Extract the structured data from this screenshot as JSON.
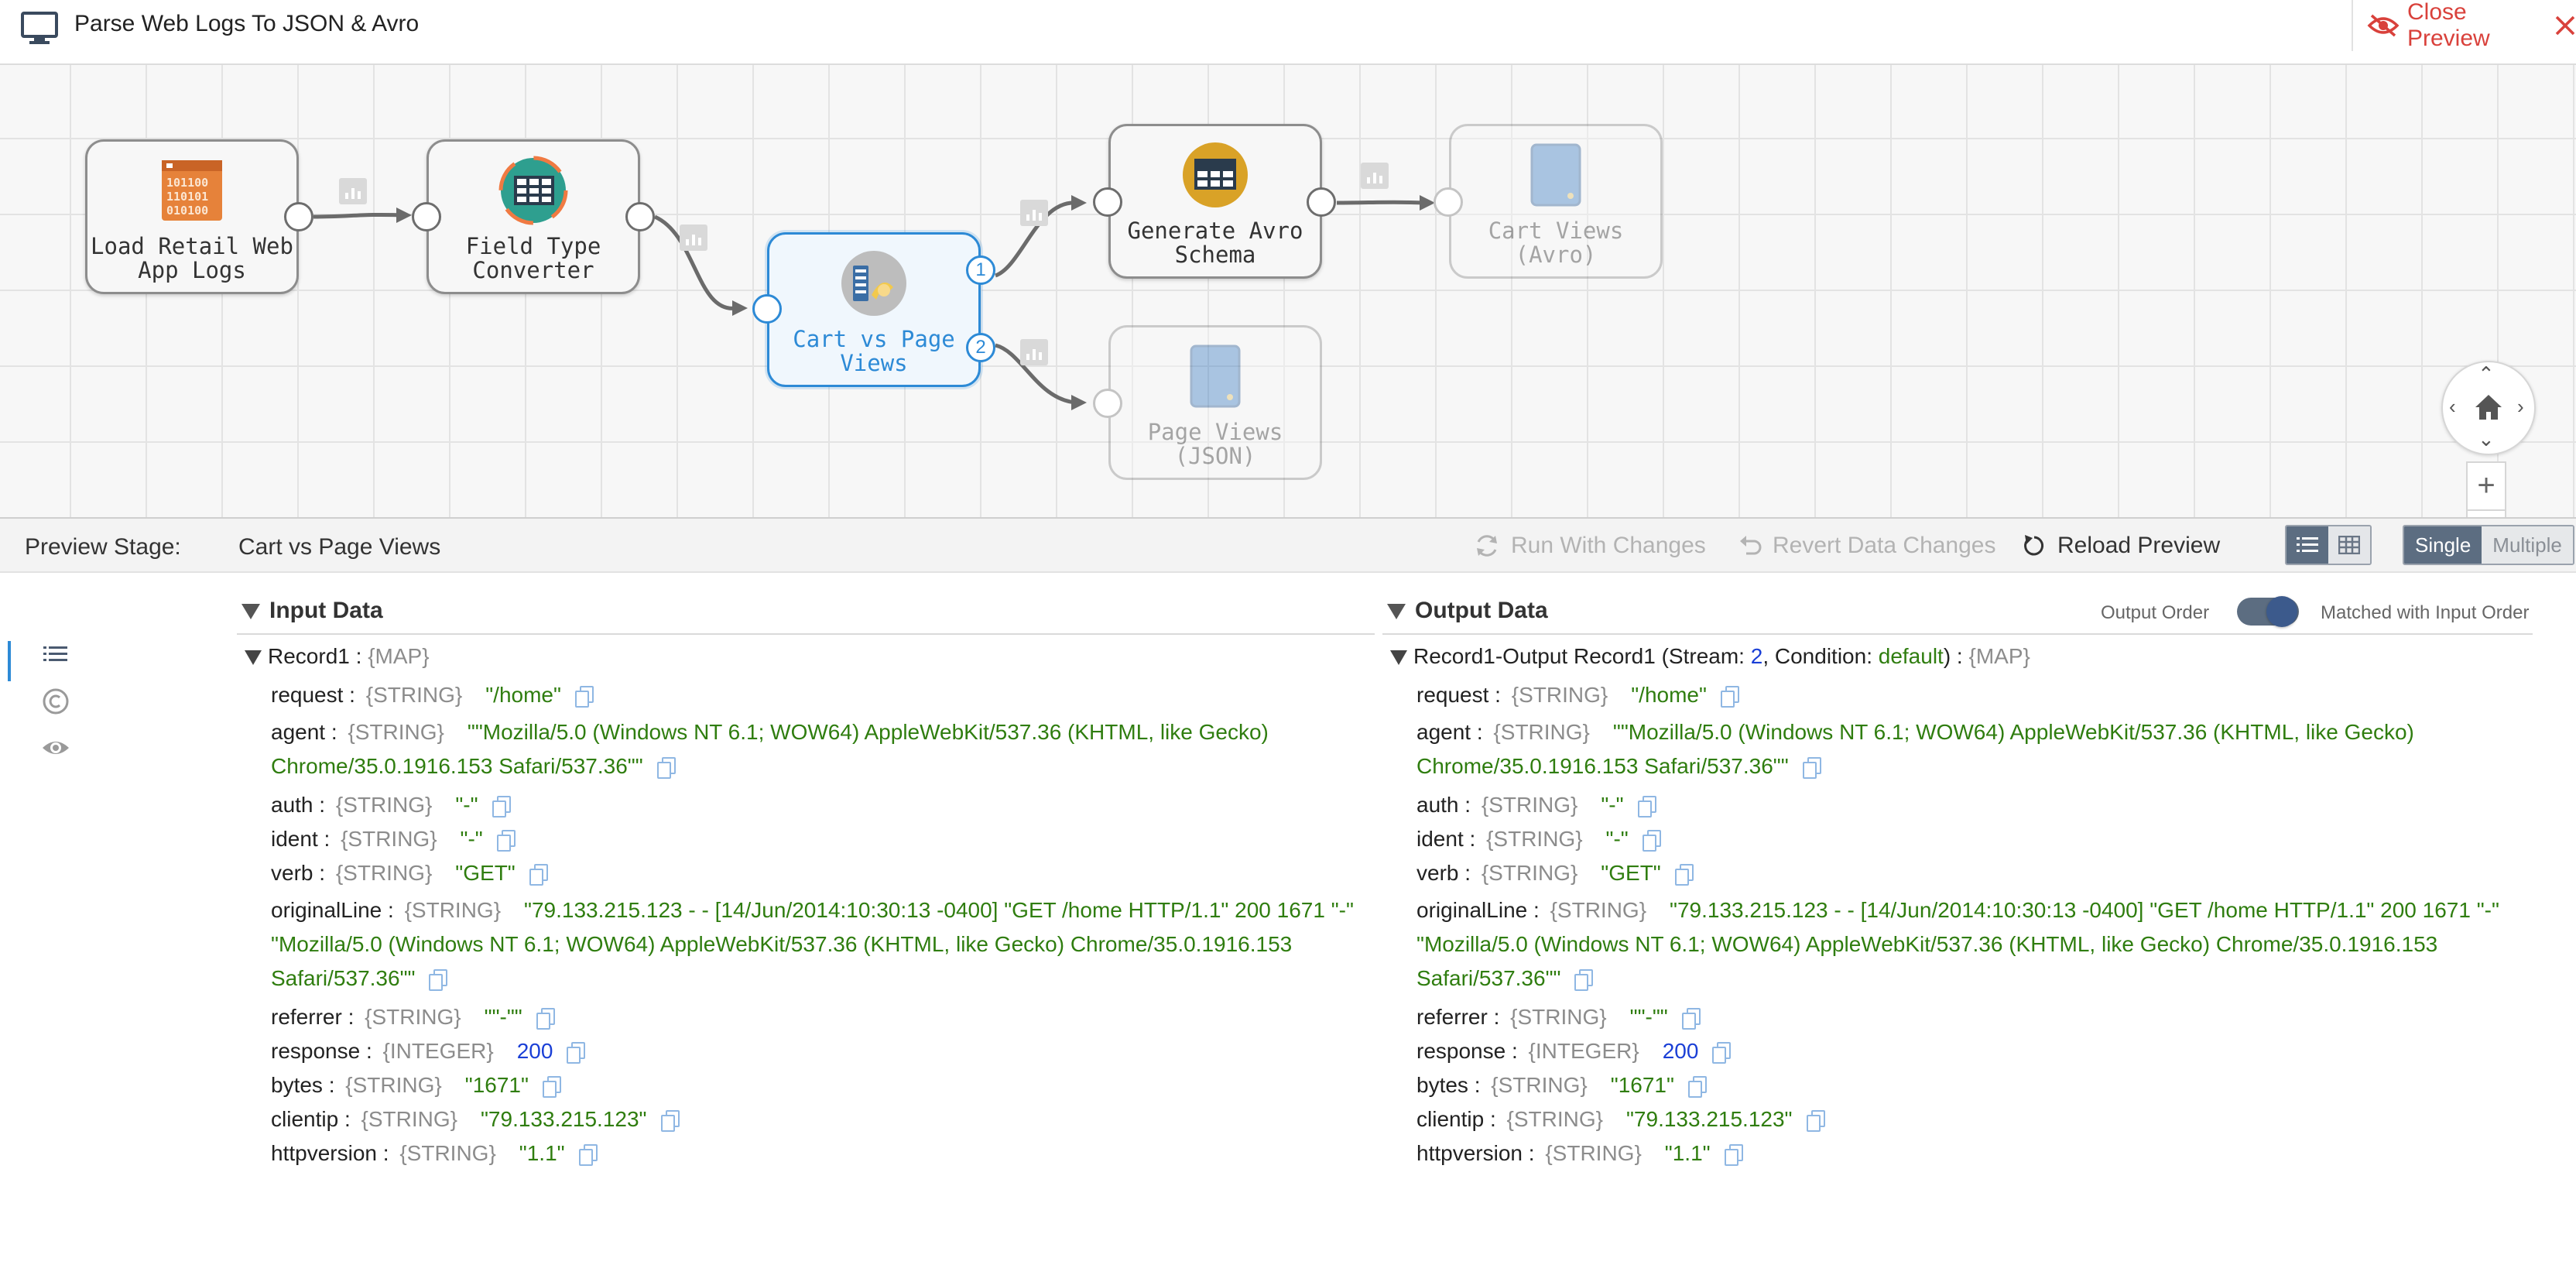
{
  "header": {
    "title": "Parse Web Logs To JSON & Avro",
    "close_label": "Close Preview"
  },
  "pipeline": {
    "nodes": [
      {
        "id": "load",
        "label": "Load Retail Web\nApp Logs",
        "icon": "log-file-icon"
      },
      {
        "id": "ftc",
        "label": "Field Type\nConverter",
        "icon": "field-type-converter-icon"
      },
      {
        "id": "cart",
        "label": "Cart vs Page\nViews",
        "icon": "stream-selector-icon",
        "selected": true
      },
      {
        "id": "avro",
        "label": "Generate Avro\nSchema",
        "icon": "avro-schema-icon"
      },
      {
        "id": "cartavro",
        "label": "Cart Views\n(Avro)",
        "icon": "destination-icon",
        "faded": true
      },
      {
        "id": "pagejson",
        "label": "Page Views\n(JSON)",
        "icon": "destination-icon",
        "faded": true
      }
    ],
    "output_port_labels": [
      "1",
      "2"
    ]
  },
  "preview_toolbar": {
    "stage_label": "Preview Stage:",
    "stage_name": "Cart vs Page Views",
    "run_with_changes": "Run With Changes",
    "revert_data_changes": "Revert Data Changes",
    "reload_preview": "Reload Preview",
    "mode_single": "Single",
    "mode_multiple": "Multiple"
  },
  "input_panel": {
    "title": "Input Data",
    "record_name": "Record1 :",
    "record_type": "{MAP}",
    "fields": [
      {
        "key": "request :",
        "type": "{STRING}",
        "value": "\"/home\"",
        "kind": "str"
      },
      {
        "key": "agent :",
        "type": "{STRING}",
        "value": "\"\"Mozilla/5.0 (Windows NT 6.1; WOW64) AppleWebKit/537.36 (KHTML, like Gecko) Chrome/35.0.1916.153 Safari/537.36\"\"",
        "kind": "wrap"
      },
      {
        "key": "auth :",
        "type": "{STRING}",
        "value": "\"-\"",
        "kind": "str"
      },
      {
        "key": "ident :",
        "type": "{STRING}",
        "value": "\"-\"",
        "kind": "str"
      },
      {
        "key": "verb :",
        "type": "{STRING}",
        "value": "\"GET\"",
        "kind": "str"
      },
      {
        "key": "originalLine :",
        "type": "{STRING}",
        "value": "\"79.133.215.123 - - [14/Jun/2014:10:30:13 -0400] \"GET /home HTTP/1.1\" 200 1671 \"-\" \"Mozilla/5.0 (Windows NT 6.1; WOW64) AppleWebKit/537.36 (KHTML, like Gecko) Chrome/35.0.1916.153 Safari/537.36\"\"",
        "kind": "wrap"
      },
      {
        "key": "referrer :",
        "type": "{STRING}",
        "value": "\"\"-\"\"",
        "kind": "str"
      },
      {
        "key": "response :",
        "type": "{INTEGER}",
        "value": "200",
        "kind": "int"
      },
      {
        "key": "bytes :",
        "type": "{STRING}",
        "value": "\"1671\"",
        "kind": "str"
      },
      {
        "key": "clientip :",
        "type": "{STRING}",
        "value": "\"79.133.215.123\"",
        "kind": "str"
      },
      {
        "key": "httpversion :",
        "type": "{STRING}",
        "value": "\"1.1\"",
        "kind": "str"
      }
    ]
  },
  "output_panel": {
    "title": "Output Data",
    "output_order_label": "Output Order",
    "matched_label": "Matched with Input Order",
    "record_name": "Record1-Output Record1 (Stream:",
    "stream_value": "2",
    "condition_label": ", Condition:",
    "condition_value": "default",
    "record_close": ") :",
    "record_type": "{MAP}",
    "fields": [
      {
        "key": "request :",
        "type": "{STRING}",
        "value": "\"/home\"",
        "kind": "str"
      },
      {
        "key": "agent :",
        "type": "{STRING}",
        "value": "\"\"Mozilla/5.0 (Windows NT 6.1; WOW64) AppleWebKit/537.36 (KHTML, like Gecko) Chrome/35.0.1916.153 Safari/537.36\"\"",
        "kind": "wrap"
      },
      {
        "key": "auth :",
        "type": "{STRING}",
        "value": "\"-\"",
        "kind": "str"
      },
      {
        "key": "ident :",
        "type": "{STRING}",
        "value": "\"-\"",
        "kind": "str"
      },
      {
        "key": "verb :",
        "type": "{STRING}",
        "value": "\"GET\"",
        "kind": "str"
      },
      {
        "key": "originalLine :",
        "type": "{STRING}",
        "value": "\"79.133.215.123 - - [14/Jun/2014:10:30:13 -0400] \"GET /home HTTP/1.1\" 200 1671 \"-\" \"Mozilla/5.0 (Windows NT 6.1; WOW64) AppleWebKit/537.36 (KHTML, like Gecko) Chrome/35.0.1916.153 Safari/537.36\"\"",
        "kind": "wrap"
      },
      {
        "key": "referrer :",
        "type": "{STRING}",
        "value": "\"\"-\"\"",
        "kind": "str"
      },
      {
        "key": "response :",
        "type": "{INTEGER}",
        "value": "200",
        "kind": "int"
      },
      {
        "key": "bytes :",
        "type": "{STRING}",
        "value": "\"1671\"",
        "kind": "str"
      },
      {
        "key": "clientip :",
        "type": "{STRING}",
        "value": "\"79.133.215.123\"",
        "kind": "str"
      },
      {
        "key": "httpversion :",
        "type": "{STRING}",
        "value": "\"1.1\"",
        "kind": "str"
      }
    ]
  },
  "colors": {
    "accent": "#2d8ad6",
    "close": "#d9413b",
    "string_value": "#2f7d0f",
    "number_value": "#1a3fd6"
  }
}
